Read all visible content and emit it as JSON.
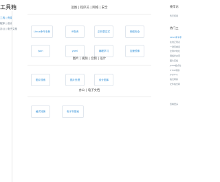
{
  "left": {
    "title": "工具箱",
    "links": [
      "工具 | 资源",
      "程序 | 设计",
      "办公 | 电子文档"
    ]
  },
  "sections": [
    {
      "title": "运维 | 程序员 | 网络 | 安全",
      "cards": [
        "Linux命令手册",
        "IP查询",
        "正则表达式",
        "网络安全",
        "json",
        "yaml",
        "编程学习",
        "加速镜像"
      ]
    },
    {
      "title": "图片 | 视频 | 音频 | 设计",
      "cards": [
        "图片搜索",
        "图片处理",
        "设计图库"
      ]
    },
    {
      "title": "办公 | 电子文档",
      "cards": [
        "格式转换",
        "电子书搜索"
      ]
    }
  ],
  "right": {
    "usage_title": "使用记",
    "usage_text": "暂无使用",
    "hot_title": "热门工",
    "hot_items": [
      "Linux命令手",
      "在线正则表",
      "一键查看自",
      "全球IP地址",
      "网络状态查",
      "图片压缩",
      "JSON格式化",
      "HTML转换",
      "jpg/png",
      "格式转换",
      "文件格式转"
    ],
    "footer": "查看更多"
  }
}
